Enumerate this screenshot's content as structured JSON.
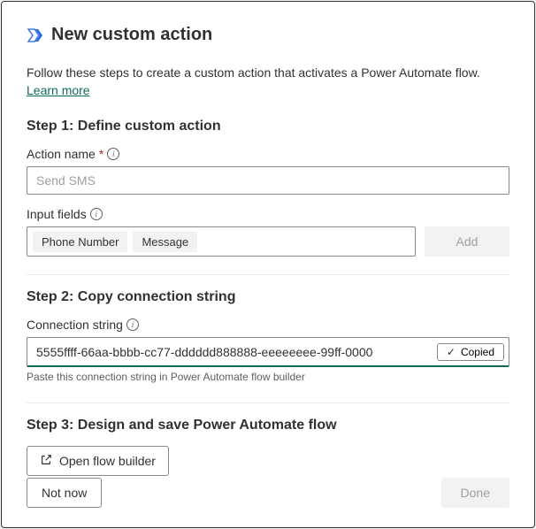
{
  "header": {
    "title": "New custom action"
  },
  "description": {
    "text": "Follow these steps to create a custom action that activates a Power Automate flow. ",
    "learn_more": "Learn more"
  },
  "step1": {
    "title": "Step 1: Define custom action",
    "action_name_label": "Action name",
    "action_name_placeholder": "Send SMS",
    "input_fields_label": "Input fields",
    "tags": [
      "Phone Number",
      "Message"
    ],
    "add_btn": "Add"
  },
  "step2": {
    "title": "Step 2: Copy connection string",
    "connection_label": "Connection string",
    "connection_value": "5555ffff-66aa-bbbb-cc77-dddddd888888-eeeeeeee-99ff-0000",
    "copied_label": "Copied",
    "helper": "Paste this connection string in Power Automate flow builder"
  },
  "step3": {
    "title": "Step 3: Design and save Power Automate flow",
    "open_flow_btn": "Open flow builder"
  },
  "footer": {
    "not_now": "Not now",
    "done": "Done"
  }
}
